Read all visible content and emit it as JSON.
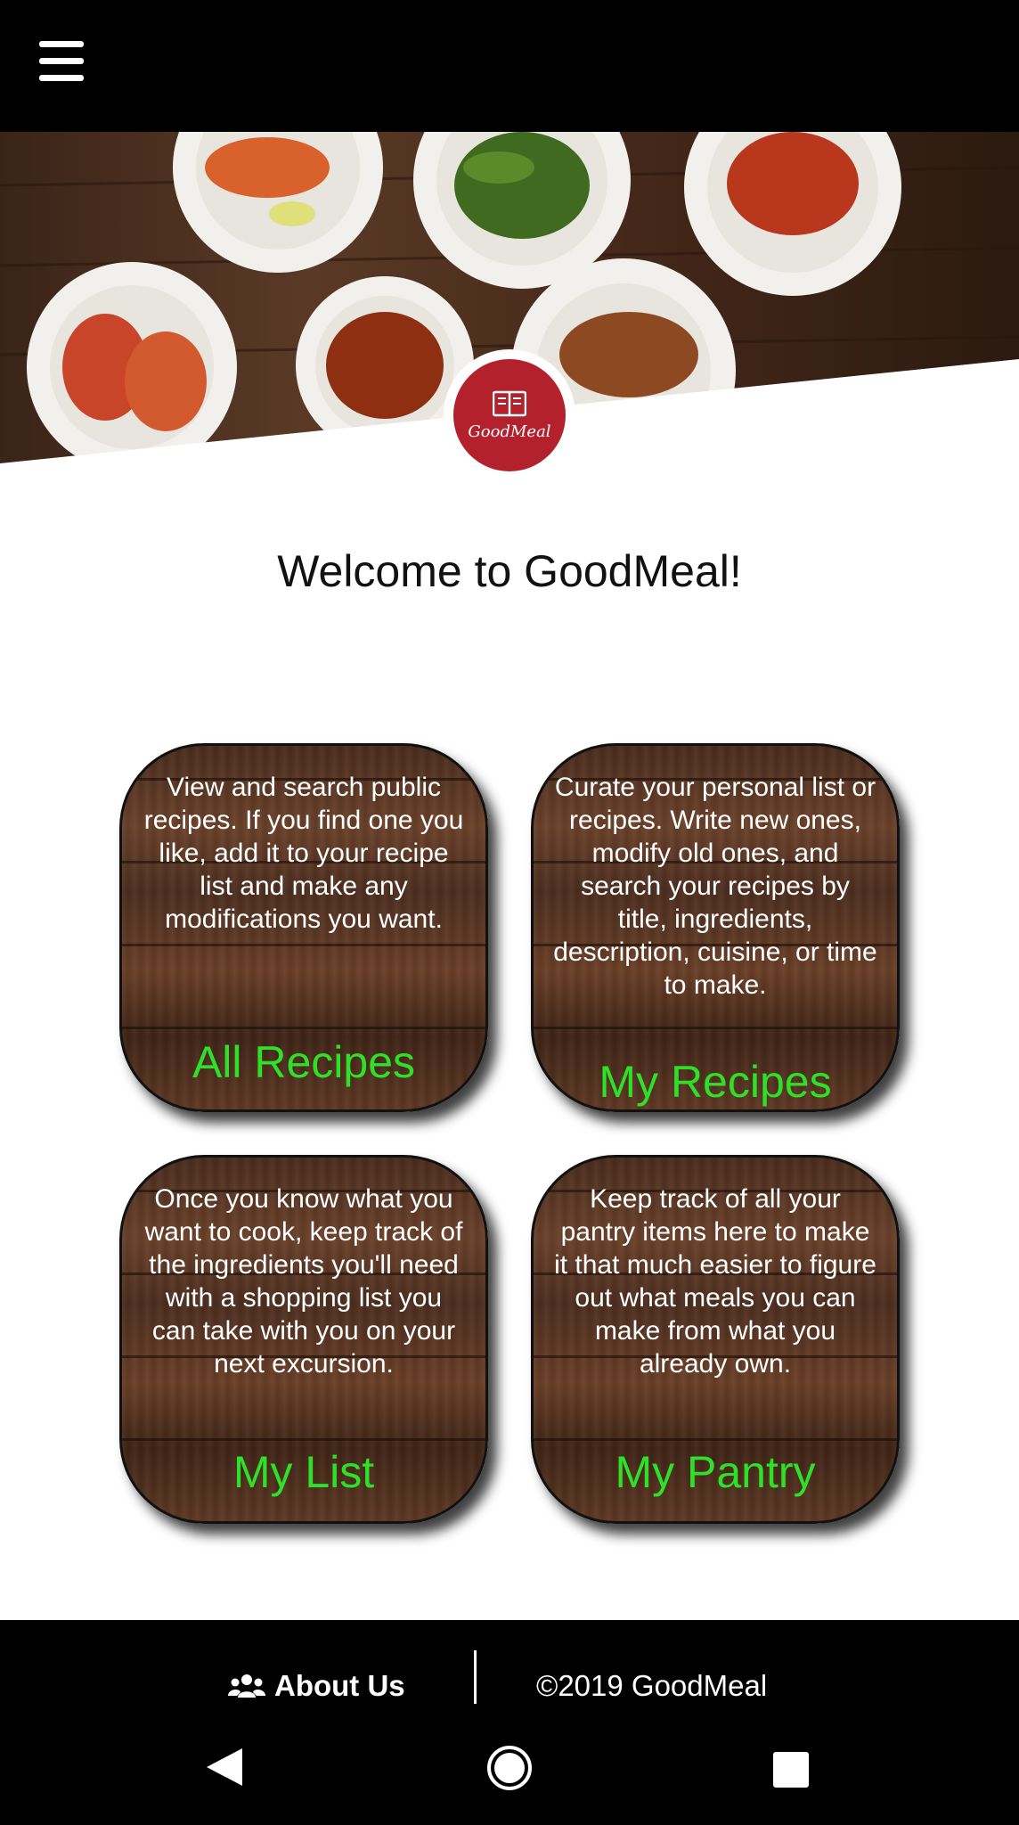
{
  "header": {
    "menu_icon": "hamburger-menu-icon"
  },
  "hero": {
    "logo_text": "GoodMeal",
    "logo_icon": "open-book-icon"
  },
  "welcome": "Welcome to GoodMeal!",
  "cards": [
    {
      "title": "All Recipes",
      "description": "View and search public recipes. If you find one you like, add it to your recipe list and make any modifications you want."
    },
    {
      "title": "My Recipes",
      "description": "Curate your personal list or recipes. Write new ones, modify old ones, and search your recipes by title, ingredients, description, cuisine, or time to make."
    },
    {
      "title": "My List",
      "description": "Once you know what you want to cook, keep track of the ingredients you'll need with a shopping list you can take with you on your next excursion."
    },
    {
      "title": "My Pantry",
      "description": "Keep track of all your pantry items here to make it that much easier to figure out what meals you can make from what you already own."
    }
  ],
  "footer": {
    "about_label": "About Us",
    "about_icon": "users-icon",
    "copyright": "©2019 GoodMeal"
  },
  "colors": {
    "accent_green": "#2fe028",
    "brand_red": "#b3222c",
    "bar_black": "#000000"
  }
}
